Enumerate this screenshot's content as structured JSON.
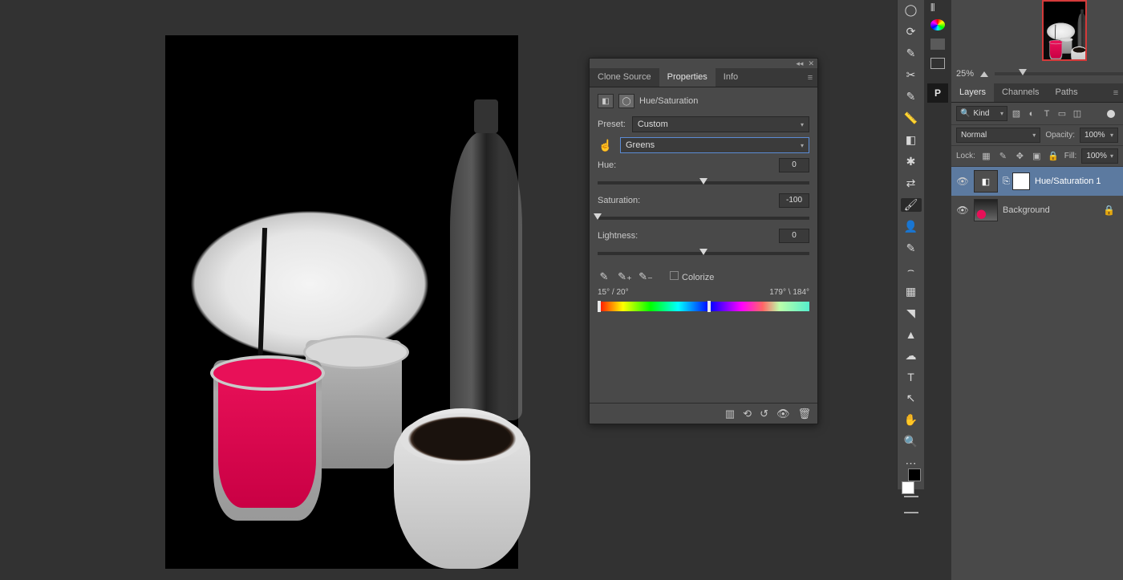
{
  "navigator": {
    "zoom_label": "25%"
  },
  "panels": {
    "layers": "Layers",
    "channels": "Channels",
    "paths": "Paths"
  },
  "layers_filter": {
    "kind_label": "Kind"
  },
  "blend": {
    "mode": "Normal",
    "opacity_label": "Opacity:",
    "opacity_value": "100%"
  },
  "lock": {
    "label": "Lock:",
    "fill_label": "Fill:",
    "fill_value": "100%"
  },
  "layers": [
    {
      "name": "Hue/Saturation 1",
      "selected": true,
      "locked": false
    },
    {
      "name": "Background",
      "selected": false,
      "locked": true
    }
  ],
  "props": {
    "tabs": {
      "clone": "Clone Source",
      "properties": "Properties",
      "info": "Info"
    },
    "title": "Hue/Saturation",
    "preset_label": "Preset:",
    "preset_value": "Custom",
    "channel_value": "Greens",
    "hue": {
      "label": "Hue:",
      "value": "0"
    },
    "sat": {
      "label": "Saturation:",
      "value": "-100"
    },
    "light": {
      "label": "Lightness:",
      "value": "0"
    },
    "colorize_label": "Colorize",
    "range": {
      "low": "15° / 20°",
      "high": "179° \\ 184°"
    }
  }
}
